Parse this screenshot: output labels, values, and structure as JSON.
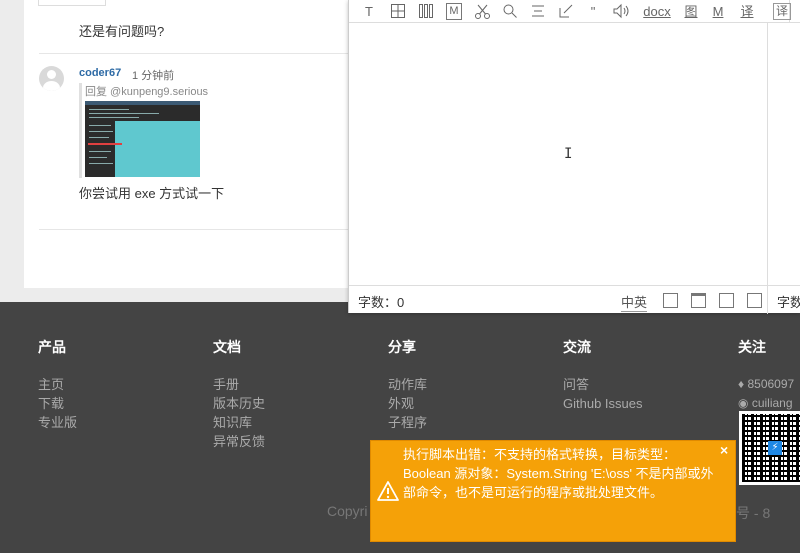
{
  "comment_thread": {
    "prev_comment_text": "还是有问题吗?",
    "reply": {
      "user": "coder67",
      "time": "1 分钟前",
      "quote_label": "回复 @kunpeng9.serious",
      "body": "你尝试用 exe 方式试一下"
    }
  },
  "editor": {
    "toolbar": {
      "title_icon": "T",
      "table_icon": "table-icon",
      "columns_icon": "columns-icon",
      "markdown_icon": "M",
      "cut_icon": "scissors-icon",
      "search_icon": "search-icon",
      "align_icon": "align-icon",
      "edit_icon": "edit-icon",
      "quote_icon": "\"",
      "speaker_icon": "speaker-icon",
      "docx_label": "docx",
      "image_label": "图",
      "m_label": "M",
      "translate_label": "译",
      "translate2_label": "译"
    },
    "word_count": "字数：0",
    "word_count_right": "字数",
    "lang_label": "中英"
  },
  "footer": {
    "columns": [
      {
        "heading": "产品",
        "links": [
          "主页",
          "下载",
          "专业版"
        ]
      },
      {
        "heading": "文档",
        "links": [
          "手册",
          "版本历史",
          "知识库",
          "异常反馈"
        ]
      },
      {
        "heading": "分享",
        "links": [
          "动作库",
          "外观",
          "子程序"
        ]
      },
      {
        "heading": "交流",
        "links": [
          "问答",
          "Github Issues"
        ]
      },
      {
        "heading": "关注",
        "links": [
          "8506097",
          "cuiliang"
        ]
      }
    ],
    "copyright": "Copyri",
    "icp": "号 - 8"
  },
  "toast": {
    "message": "执行脚本出错：不支持的格式转换，目标类型：Boolean 源对象：System.String  'E:\\oss' 不是内部或外部命令，也不是可运行的程序或批处理文件。",
    "close": "×"
  }
}
